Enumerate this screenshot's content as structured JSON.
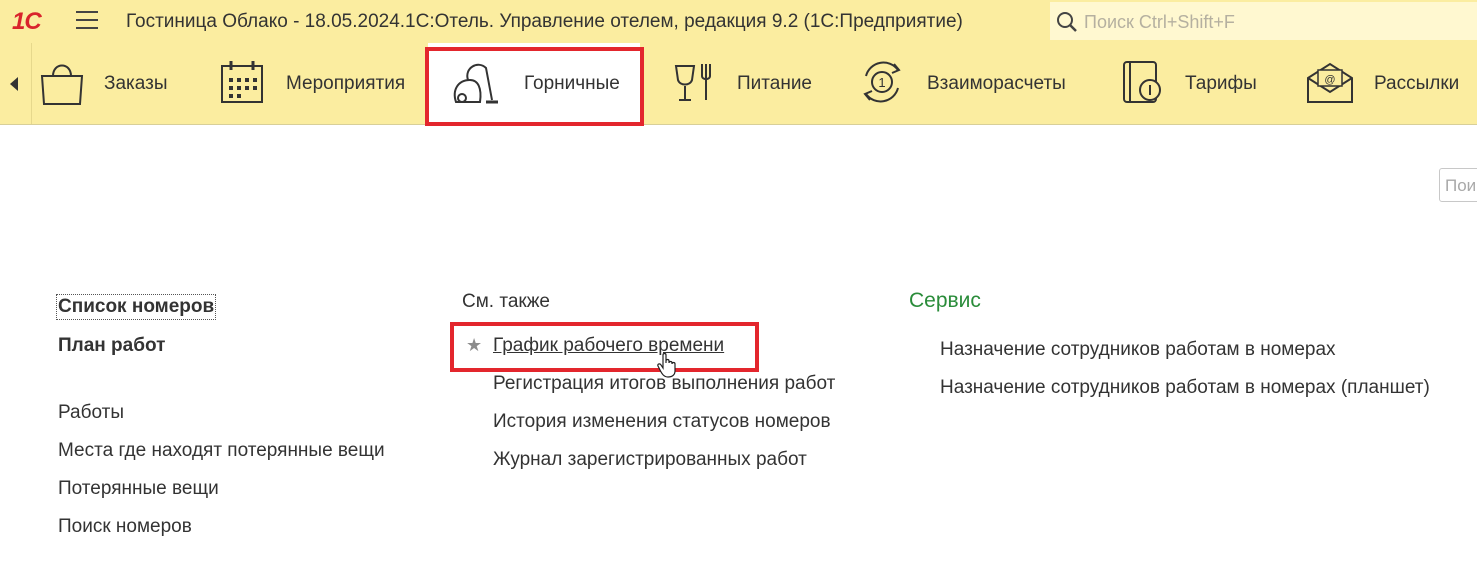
{
  "titlebar": {
    "logo": "1С",
    "title": "Гостиница Облако - 18.05.2024.1С:Отель. Управление отелем, редакция 9.2  (1С:Предприятие)",
    "search_placeholder": "Поиск Ctrl+Shift+F"
  },
  "sections": [
    {
      "label": "Заказы",
      "icon": "shopping-bag-icon"
    },
    {
      "label": "Мероприятия",
      "icon": "calendar-icon"
    },
    {
      "label": "Горничные",
      "icon": "vacuum-cleaner-icon",
      "active": true
    },
    {
      "label": "Питание",
      "icon": "glass-fork-icon"
    },
    {
      "label": "Взаиморасчеты",
      "icon": "coin-cycle-icon"
    },
    {
      "label": "Тарифы",
      "icon": "price-book-icon"
    },
    {
      "label": "Рассылки",
      "icon": "email-envelope-icon"
    }
  ],
  "right_field": {
    "placeholder": "Пои"
  },
  "left_column": {
    "items": [
      "Список номеров",
      "План работ",
      "Работы",
      "Места где находят потерянные вещи",
      "Потерянные вещи",
      "Поиск номеров"
    ]
  },
  "see_also": {
    "heading": "См. также",
    "items": [
      "График рабочего времени",
      "Регистрация итогов выполнения работ",
      "История изменения статусов номеров",
      "Журнал зарегистрированных работ"
    ]
  },
  "service": {
    "heading": "Сервис",
    "items": [
      "Назначение сотрудников работам в номерах",
      "Назначение сотрудников работам в номерах (планшет)"
    ]
  },
  "colors": {
    "panel": "#fbeda0",
    "highlight_frame": "#e3262d",
    "service_heading": "#2a8c3a",
    "logo": "#d9242c"
  }
}
